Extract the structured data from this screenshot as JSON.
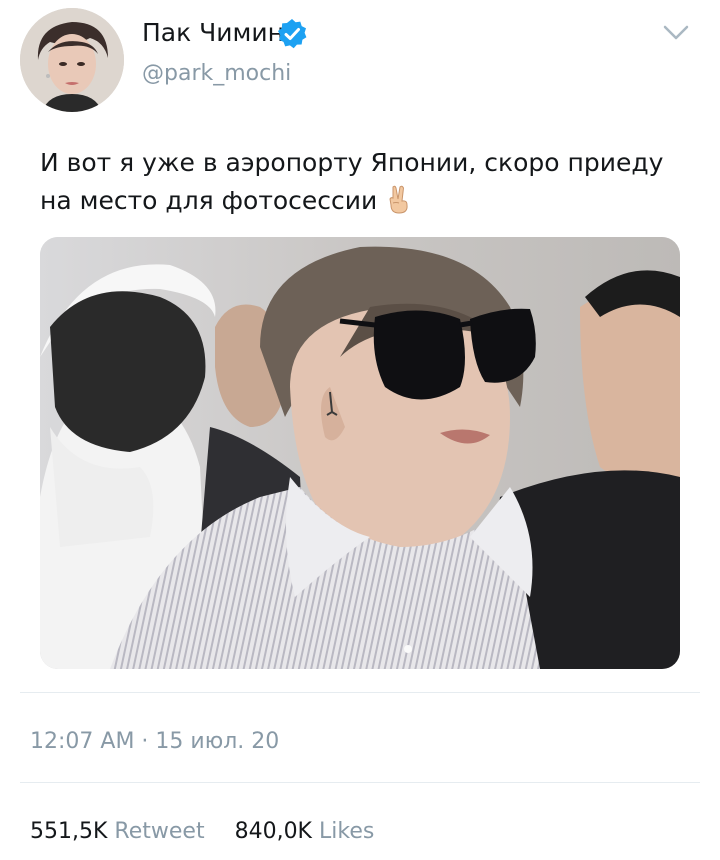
{
  "author": {
    "display_name": "Пак Чимин.",
    "handle": "@park_mochi",
    "verified": true,
    "avatar_icon": "profile-photo"
  },
  "tweet": {
    "text": "И вот я уже в аэропорту Японии, скоро приеду на место для фотосессии",
    "emoji": "✌🏼",
    "media_icon": "photo"
  },
  "meta": {
    "timestamp": "12:07 AM · 15 июл. 20"
  },
  "stats": {
    "retweets_count": "551,5K",
    "retweets_label": "Retweet",
    "likes_count": "840,0K",
    "likes_label": "Likes"
  },
  "colors": {
    "verified": "#1da1f2",
    "secondary_text": "#8899a6",
    "primary_text": "#14171a",
    "divider": "#e6ecf0"
  }
}
